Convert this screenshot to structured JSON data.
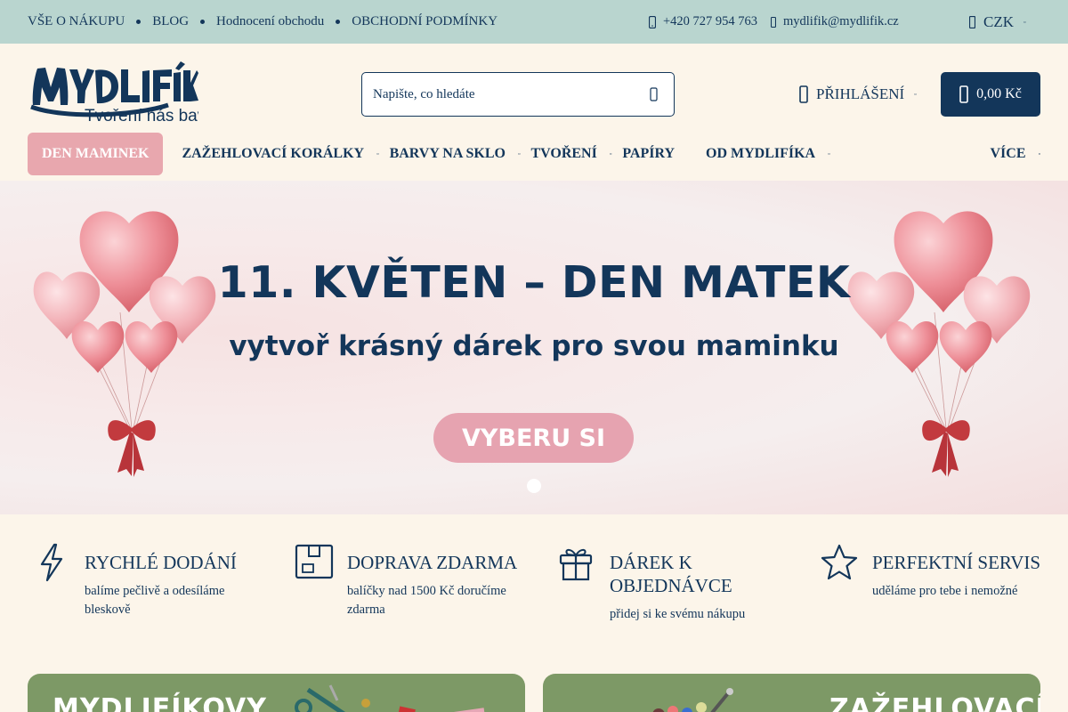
{
  "topbar": {
    "links": [
      "VŠE O NÁKUPU",
      "BLOG",
      "Hodnocení obchodu",
      "OBCHODNÍ PODMÍNKY"
    ],
    "phone": "+420 727 954 763",
    "email": "mydlifik@mydlifik.cz",
    "currency": "CZK"
  },
  "header": {
    "logo_text": "MYDLIFÍK",
    "logo_tagline": "Tvoření nás baví",
    "search_placeholder": "Napište, co hledáte",
    "login_label": "PŘIHLÁŠENÍ",
    "cart_total": "0,00 Kč"
  },
  "nav": {
    "items": [
      {
        "label": "DEN MAMINEK"
      },
      {
        "label": "ZAŽEHLOVACÍ KORÁLKY"
      },
      {
        "label": "BARVY NA SKLO"
      },
      {
        "label": "TVOŘENÍ"
      },
      {
        "label": "PAPÍRY"
      },
      {
        "label": "OD MYDLIFÍKA"
      },
      {
        "label": "VÍCE"
      }
    ]
  },
  "hero": {
    "title": "11. KVĚTEN – DEN MATEK",
    "subtitle": "vytvoř krásný dárek pro svou maminku",
    "cta": "VYBERU SI"
  },
  "features": [
    {
      "icon": "lightning-icon",
      "title": "RYCHLÉ DODÁNÍ",
      "desc": "balíme pečlivě a odesíláme bleskově"
    },
    {
      "icon": "box-icon",
      "title": "DOPRAVA ZDARMA",
      "desc": "balíčky nad 1500 Kč doručíme zdarma"
    },
    {
      "icon": "gift-icon",
      "title": "DÁREK K OBJEDNÁVCE",
      "desc": "přidej si ke svému nákupu"
    },
    {
      "icon": "star-icon",
      "title": "PERFEKTNÍ SERVIS",
      "desc": "uděláme pro tebe i nemožné"
    }
  ],
  "promo_cards": [
    {
      "title": "MYDLIFÍKOVY"
    },
    {
      "title": "ZAŽEHLOVACÍ"
    }
  ],
  "colors": {
    "primary": "#13365a",
    "topbar_bg": "#b9d5cf",
    "page_bg": "#fcf5ea",
    "accent_pink": "#e8a7ae",
    "card_green": "#7d9966"
  }
}
